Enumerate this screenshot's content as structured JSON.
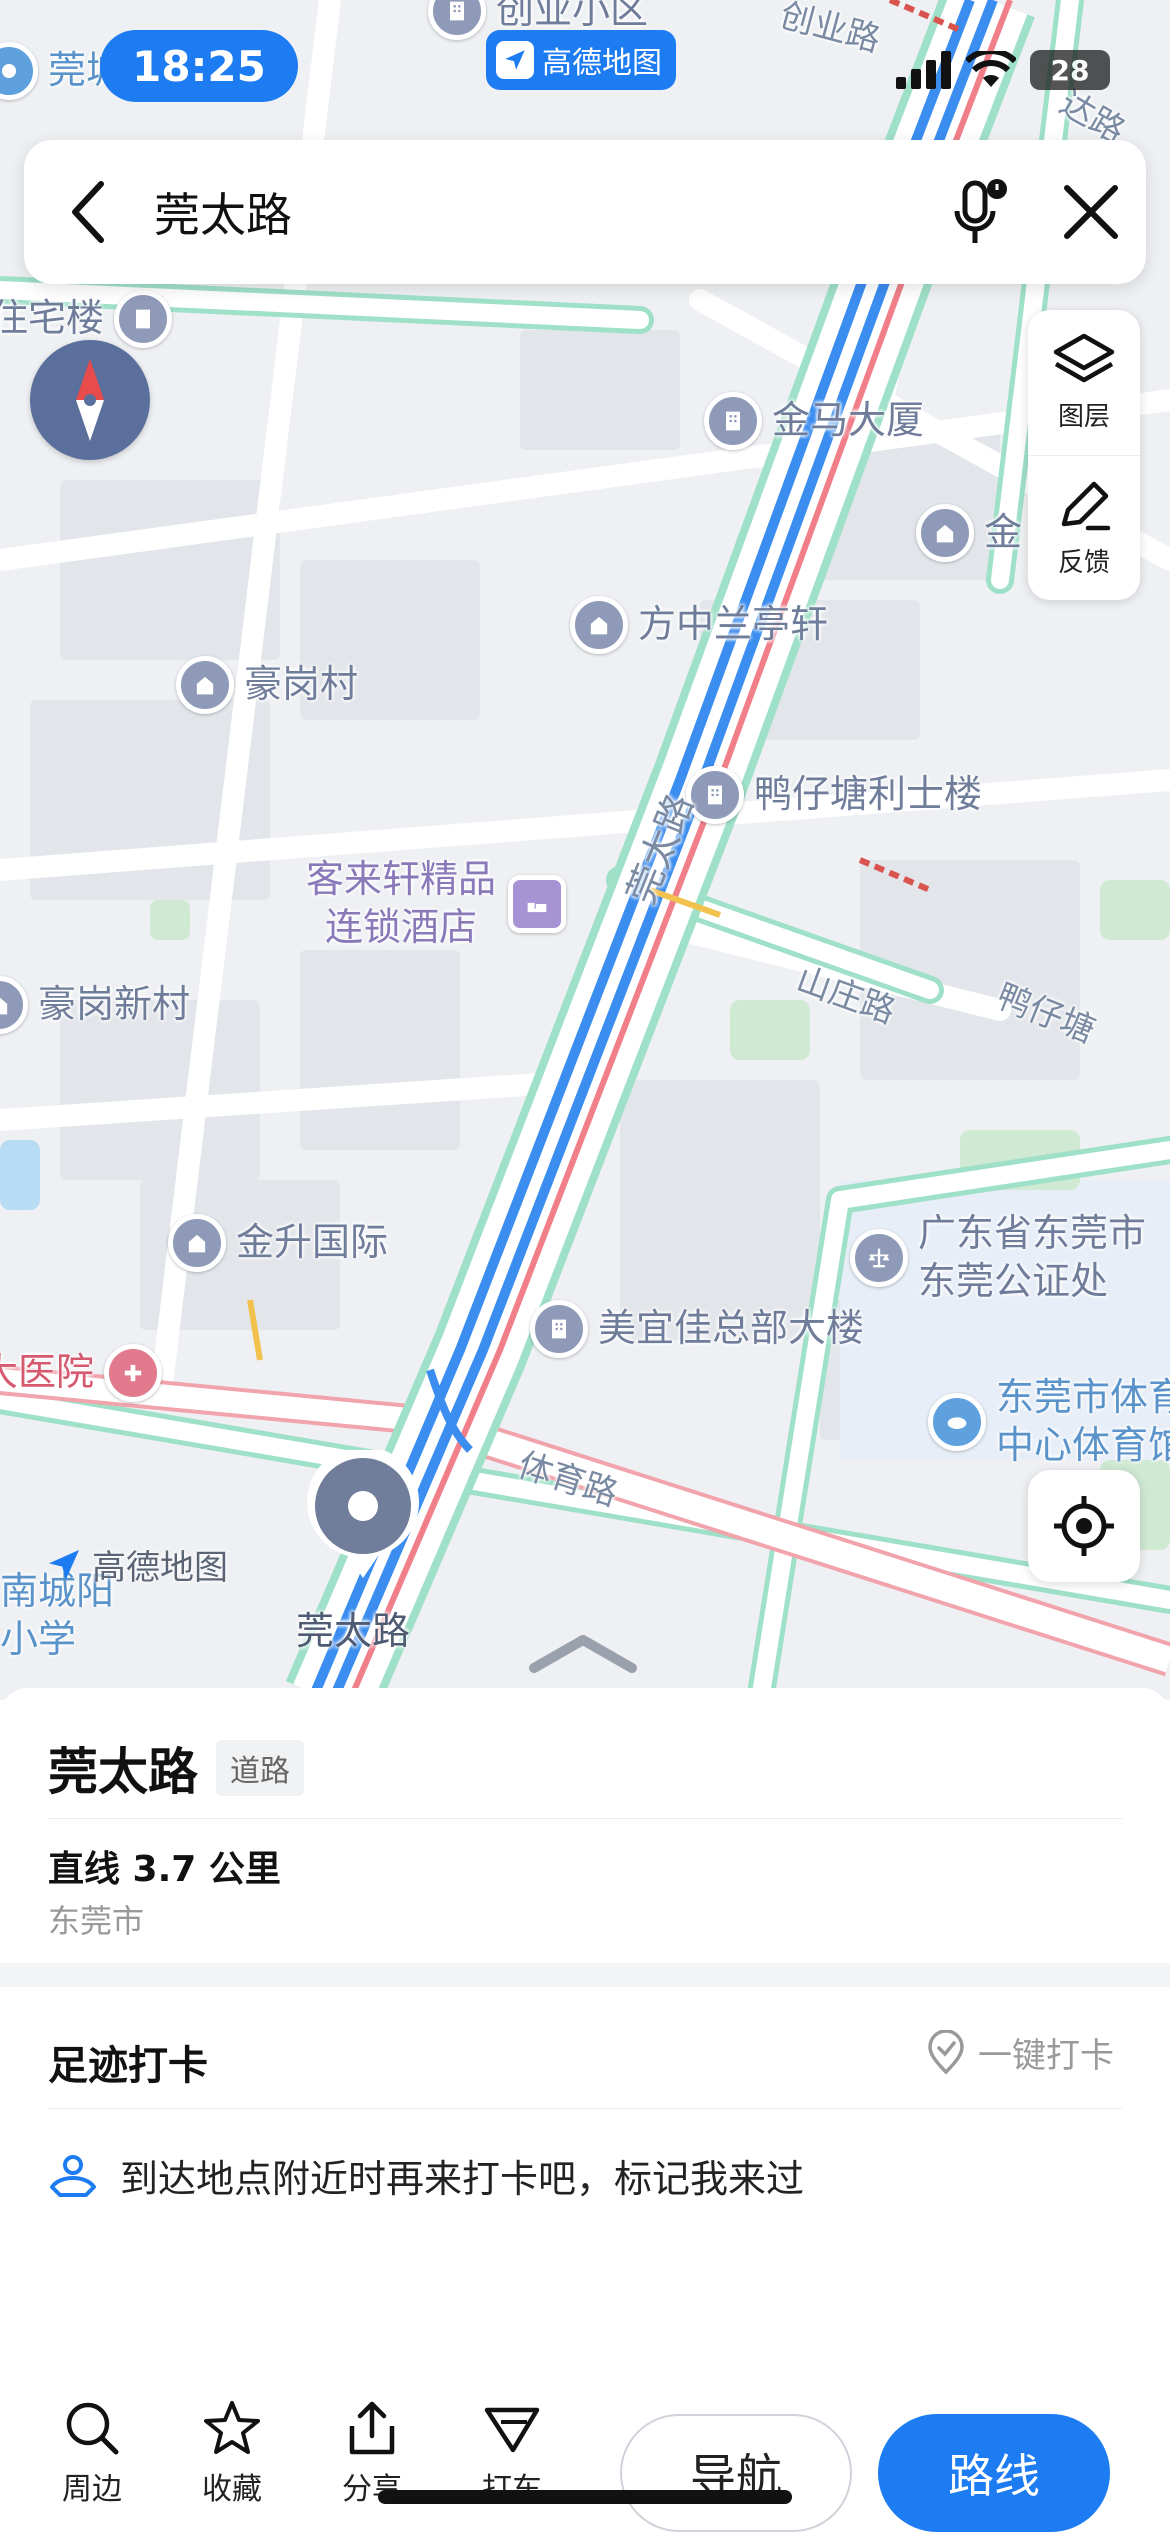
{
  "status": {
    "time": "18:25",
    "app_badge": "高德地图",
    "battery": "28"
  },
  "search": {
    "query": "莞太路"
  },
  "tools": {
    "layers_label": "图层",
    "feedback_label": "反馈"
  },
  "map": {
    "pois": [
      {
        "name": "创业小区",
        "style": "gray"
      },
      {
        "name": "莞城",
        "style": "blue"
      },
      {
        "name": "住宅楼",
        "style": "gray"
      },
      {
        "name": "金马大厦",
        "style": "gray"
      },
      {
        "name": "金",
        "style": "gray"
      },
      {
        "name": "方中兰亭轩",
        "style": "gray"
      },
      {
        "name": "豪岗村",
        "style": "gray"
      },
      {
        "name": "鸭仔塘利士楼",
        "style": "gray"
      },
      {
        "name": "客来轩精品\n连锁酒店",
        "style": "purple"
      },
      {
        "name": "豪岗新村",
        "style": "gray"
      },
      {
        "name": "金升国际",
        "style": "gray"
      },
      {
        "name": "广东省东莞市\n东莞公证处",
        "style": "gray"
      },
      {
        "name": "美宜佳总部大楼",
        "style": "gray"
      },
      {
        "name": "东莞市体育\n中心体育馆",
        "style": "blue"
      },
      {
        "name": "大医院",
        "style": "pink"
      },
      {
        "name": "南城阳\n小学",
        "style": "blue"
      }
    ],
    "roads": {
      "main": "莞太路",
      "r1": "创业路",
      "r2": "达路",
      "r3": "山庄路",
      "r4": "鸭仔塘",
      "r5": "体育路"
    },
    "logo": "高德地图",
    "marker_label": "莞太路"
  },
  "place": {
    "name": "莞太路",
    "tag": "道路",
    "distance": "直线 3.7 公里",
    "city": "东莞市"
  },
  "checkin": {
    "title": "足迹打卡",
    "button": "一键打卡",
    "tip": "到达地点附近时再来打卡吧，标记我来过"
  },
  "actions": {
    "nearby": "周边",
    "favorite": "收藏",
    "share": "分享",
    "taxi": "打车",
    "navigate": "导航",
    "route": "路线"
  },
  "colors": {
    "accent": "#1d7cf2",
    "road_blue": "#3b8df0",
    "road_green": "#8fdcc0",
    "road_red": "#f07f8a"
  }
}
